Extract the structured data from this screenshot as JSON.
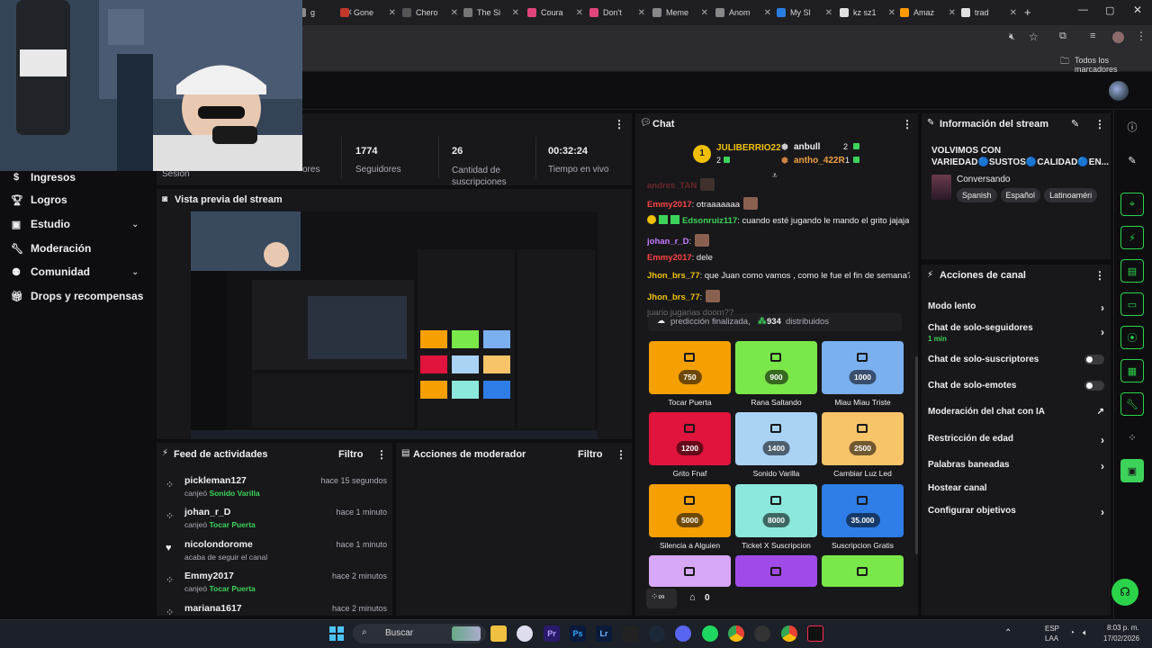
{
  "browser": {
    "tabs": [
      {
        "label": "g",
        "fav": "#8a8a8a"
      },
      {
        "label": "Gone",
        "fav": "#c0392b"
      },
      {
        "label": "Chero",
        "fav": "#555"
      },
      {
        "label": "The Si",
        "fav": "#777"
      },
      {
        "label": "Coura",
        "fav": "#e0457b"
      },
      {
        "label": "Don't",
        "fav": "#e0457b"
      },
      {
        "label": "Meme",
        "fav": "#888"
      },
      {
        "label": "Anom",
        "fav": "#888"
      },
      {
        "label": "My Sl",
        "fav": "#2a7de1"
      },
      {
        "label": "kz sz1",
        "fav": "#e0e0e0"
      },
      {
        "label": "Amaz",
        "fav": "#ff9900"
      },
      {
        "label": "trad",
        "fav": "#e0e0e0"
      }
    ],
    "new_tab": "+",
    "bookmarks_label": "Todos los marcadores"
  },
  "left_nav": {
    "items": [
      {
        "label": "Ingresos",
        "icon": "dollar-icon"
      },
      {
        "label": "Logros",
        "icon": "trophy-icon"
      },
      {
        "label": "Estudio",
        "icon": "studio-icon"
      },
      {
        "label": "Moderación",
        "icon": "wrench-icon"
      },
      {
        "label": "Comunidad",
        "icon": "community-icon"
      },
      {
        "label": "Drops y recompensas",
        "icon": "gift-icon"
      }
    ]
  },
  "stats": {
    "partial_label_1": "Sesión",
    "partial_label_2": "ores",
    "items": [
      {
        "value": "1774",
        "label": "Seguidores"
      },
      {
        "value": "26",
        "label": "Cantidad de suscripciones"
      },
      {
        "value": "00:32:24",
        "label": "Tiempo en vivo"
      }
    ]
  },
  "preview": {
    "title": "Vista previa del stream"
  },
  "activity_feed": {
    "title": "Feed de actividades",
    "filter": "Filtro",
    "items": [
      {
        "name": "pickleman127",
        "verb": "canjeó",
        "reward": "Sonido Varilla",
        "time": "hace 15 segundos",
        "icon": "points-icon"
      },
      {
        "name": "johan_r_D",
        "verb": "canjeó",
        "reward": "Tocar Puerta",
        "time": "hace 1 minuto",
        "icon": "points-icon"
      },
      {
        "name": "nicolondorome",
        "verb": "acaba de seguir el canal",
        "reward": "",
        "time": "hace 1 minuto",
        "icon": "heart-icon"
      },
      {
        "name": "Emmy2017",
        "verb": "canjeó",
        "reward": "Tocar Puerta",
        "time": "hace 2 minutos",
        "icon": "points-icon"
      },
      {
        "name": "mariana1617",
        "verb": "",
        "reward": "",
        "time": "hace 2 minutos",
        "icon": "points-icon"
      }
    ]
  },
  "mod_actions": {
    "title": "Acciones de moderador",
    "filter": "Filtro"
  },
  "chat": {
    "title": "Chat",
    "leaderboard": {
      "first": {
        "rank": "1",
        "name": "JULIBERRIO22",
        "points": "2"
      },
      "second": {
        "name": "anbull",
        "points": "2"
      },
      "third": {
        "name": "antho_422R",
        "points": "1"
      }
    },
    "messages": [
      {
        "user": "andres_TAN",
        "text": "",
        "color": "u-red"
      },
      {
        "user": "Emmy2017",
        "text": ": otraaaaaaa",
        "color": "u-red"
      },
      {
        "user": "Edsonruiz117",
        "text": ": cuando esté jugando le mando el grito jajaja",
        "color": "u-grn"
      },
      {
        "user": "johan_r_D",
        "text": ":",
        "color": "u-pur"
      },
      {
        "user": "Emmy2017",
        "text": ": dele",
        "color": "u-red"
      },
      {
        "user": "Jhon_brs_77",
        "text": ": que Juan como vamos , como le fue el fin de semana?",
        "color": "u-yel"
      },
      {
        "user": "Jhon_brs_77",
        "text": ":",
        "color": "u-yel"
      },
      {
        "user": "",
        "text": "juario jugarias doom??",
        "color": "u-yel"
      }
    ],
    "prediction": {
      "prefix": "predicción finalizada,",
      "amount": "934",
      "suffix": "distribuidos"
    },
    "rewards": [
      {
        "cost": "750",
        "label": "Tocar Puerta",
        "color": "#f5a000"
      },
      {
        "cost": "900",
        "label": "Rana Saltando",
        "color": "#7be84a"
      },
      {
        "cost": "1000",
        "label": "Miau Miau Triste",
        "color": "#7ab0f0"
      },
      {
        "cost": "1200",
        "label": "Grito Fnaf",
        "color": "#e0143c"
      },
      {
        "cost": "1400",
        "label": "Sonido Varilla",
        "color": "#a9d2f5"
      },
      {
        "cost": "2500",
        "label": "Cambiar Luz Led",
        "color": "#f8c46a"
      },
      {
        "cost": "5000",
        "label": "Silencia a Alguien",
        "color": "#f5a000"
      },
      {
        "cost": "8000",
        "label": "Ticket X Suscripcion",
        "color": "#8be8dc"
      },
      {
        "cost": "35.000",
        "label": "Suscripcion Gratis",
        "color": "#2f7ee8"
      },
      {
        "cost": "",
        "label": "",
        "color": "#d8a8f8"
      },
      {
        "cost": "",
        "label": "",
        "color": "#a04ae8"
      },
      {
        "cost": "",
        "label": "",
        "color": "#7be84a"
      }
    ],
    "footer_points": "0"
  },
  "stream_info": {
    "title": "Información del stream",
    "stream_title": "VOLVIMOS CON VARIEDAD🔵SUSTOS🔵CALIDAD🔵EN...",
    "category": "Conversando",
    "tags": [
      "Spanish",
      "Español",
      "Latinoaméri"
    ]
  },
  "channel_actions": {
    "title": "Acciones de canal",
    "items": [
      {
        "label": "Modo lento",
        "sub": "",
        "control": "chevron"
      },
      {
        "label": "Chat de solo-seguidores",
        "sub": "1 min",
        "control": "chevron"
      },
      {
        "label": "Chat de solo-suscriptores",
        "sub": "",
        "control": "toggle"
      },
      {
        "label": "Chat de solo-emotes",
        "sub": "",
        "control": "toggle"
      },
      {
        "label": "Moderación del chat con IA",
        "sub": "",
        "control": "external"
      },
      {
        "label": "Restricción de edad",
        "sub": "",
        "control": "chevron"
      },
      {
        "label": "Palabras baneadas",
        "sub": "",
        "control": "chevron"
      },
      {
        "label": "Hostear canal",
        "sub": "",
        "control": "none"
      },
      {
        "label": "Configurar objetivos",
        "sub": "",
        "control": "chevron"
      }
    ]
  },
  "taskbar": {
    "search_placeholder": "Buscar",
    "lang_top": "ESP",
    "lang_bottom": "LAA",
    "time": "8:03 p. m.",
    "date": "17/02/2026"
  },
  "colors": {
    "accent_green": "#2bd34a",
    "panel": "#18181b",
    "bg": "#0e0e10"
  }
}
